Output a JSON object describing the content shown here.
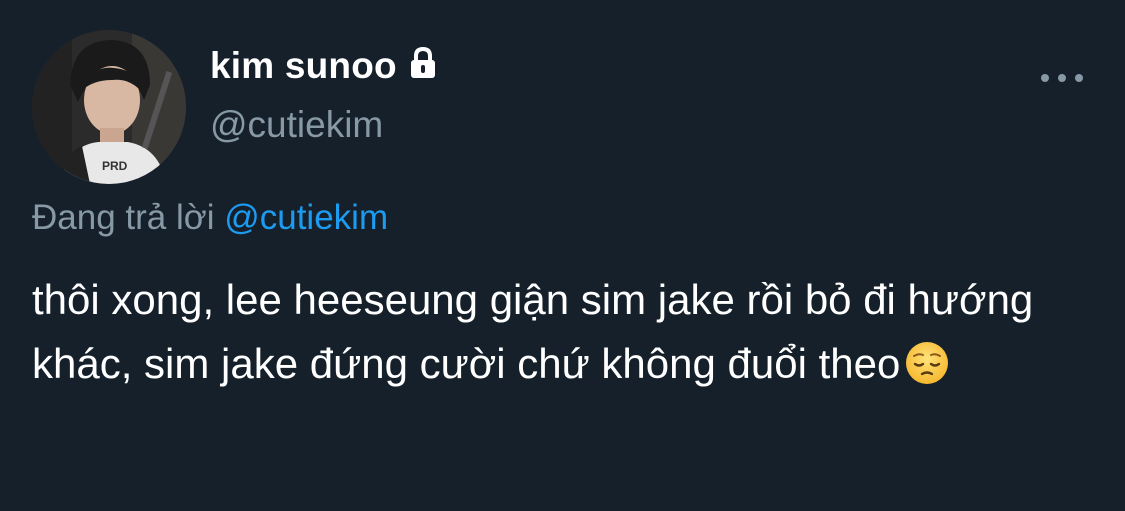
{
  "tweet": {
    "display_name": "kim sunoo",
    "handle": "@cutiekim",
    "replying_prefix": "Đang trả lời ",
    "replying_to": "@cutiekim",
    "text": "thôi xong, lee heeseung giận sim jake rồi bỏ đi hướng khác, sim jake đứng cười chứ không đuổi theo",
    "emoji": "pensive-face",
    "icons": {
      "lock": "lock-icon",
      "more": "more-options-icon"
    }
  },
  "colors": {
    "background": "#15202b",
    "primary_text": "#ffffff",
    "secondary_text": "#8899a6",
    "accent": "#1d9bf0"
  }
}
